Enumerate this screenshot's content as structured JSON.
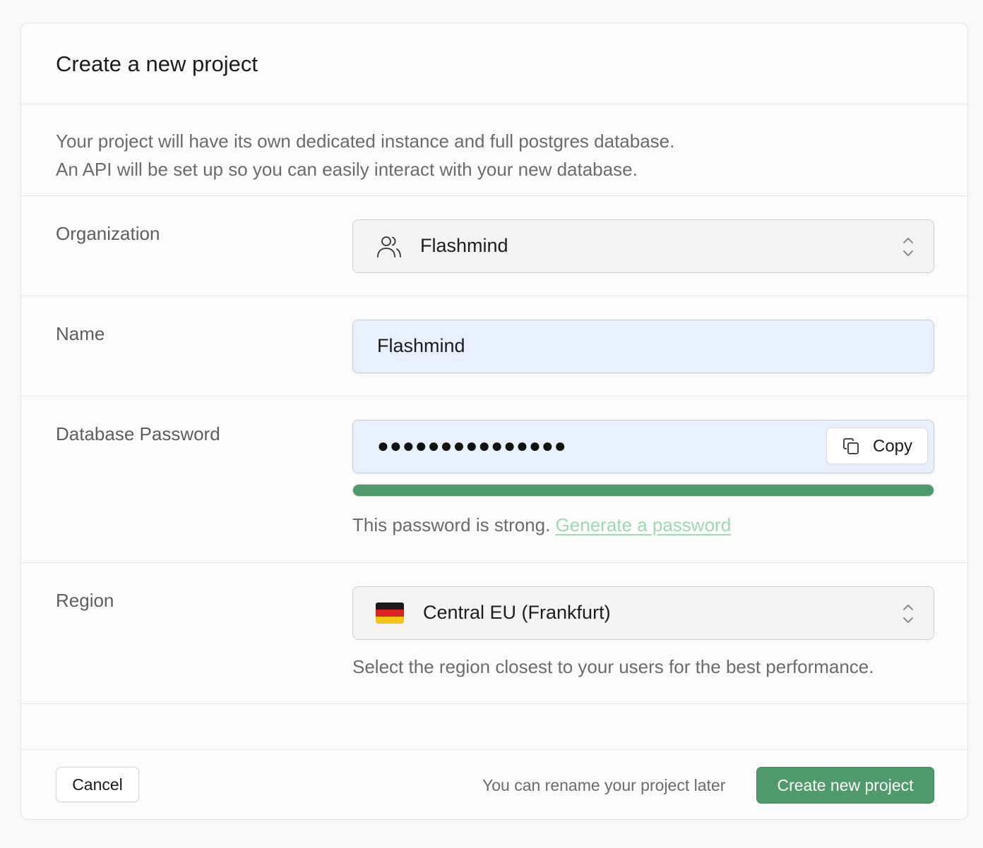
{
  "header": {
    "title": "Create a new project"
  },
  "intro": {
    "line1": "Your project will have its own dedicated instance and full postgres database.",
    "line2": "An API will be set up so you can easily interact with your new database."
  },
  "organization": {
    "label": "Organization",
    "value": "Flashmind",
    "icon": "users-icon"
  },
  "name": {
    "label": "Name",
    "value": "Flashmind"
  },
  "password": {
    "label": "Database Password",
    "masked_value": "●●●●●●●●●●●●●●●",
    "copy_label": "Copy",
    "strength": 1.0,
    "strength_text": "This password is strong.",
    "generate_link": "Generate a password",
    "strength_color": "#4f9a6a"
  },
  "region": {
    "label": "Region",
    "value": "Central EU (Frankfurt)",
    "flag": "germany-flag",
    "hint": "Select the region closest to your users for the best performance."
  },
  "footer": {
    "cancel_label": "Cancel",
    "rename_note": "You can rename your project later",
    "create_label": "Create new project",
    "accent": "#4f9a6a"
  }
}
